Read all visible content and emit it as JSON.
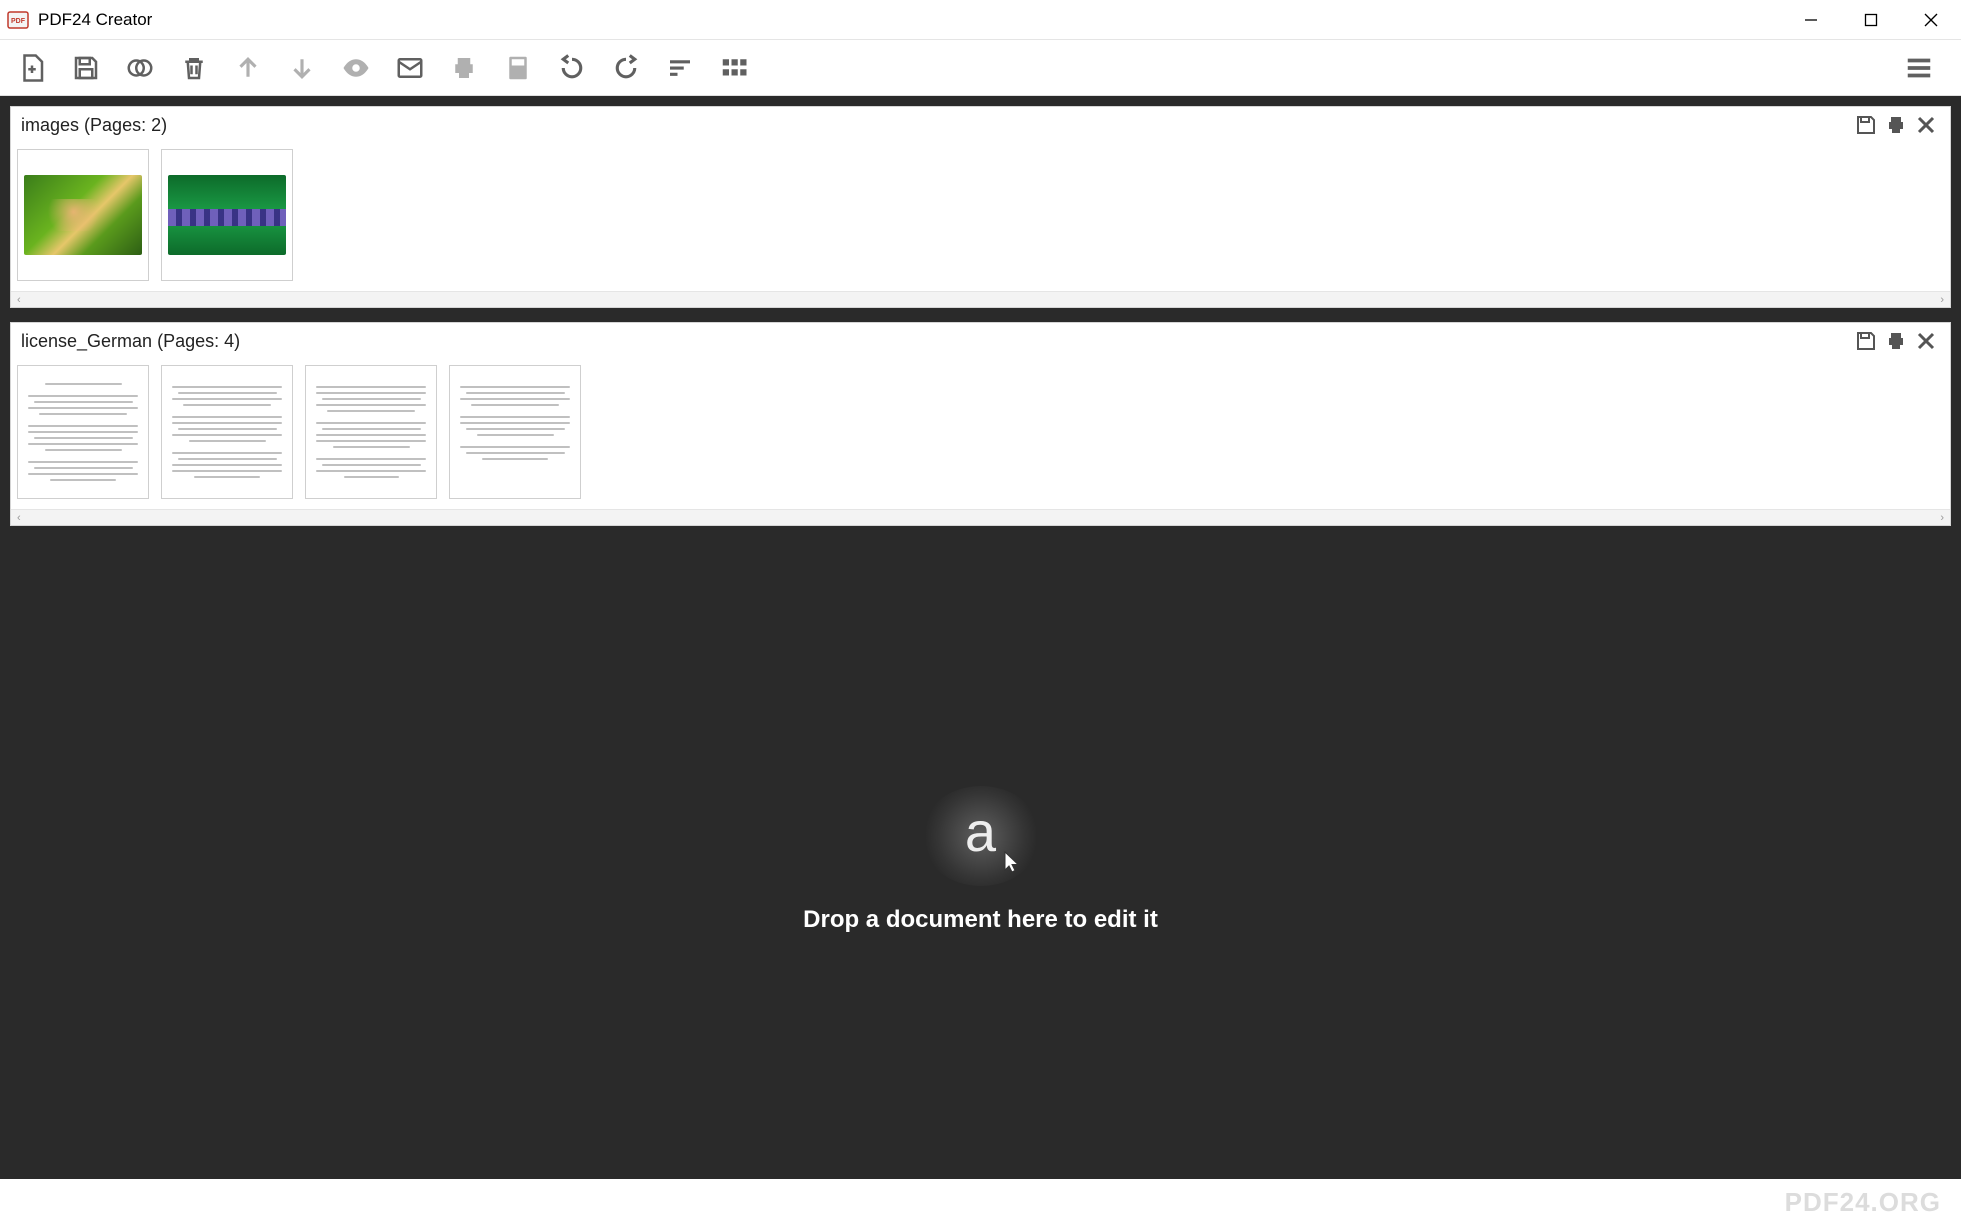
{
  "window": {
    "title": "PDF24 Creator"
  },
  "documents": [
    {
      "name": "images",
      "pages_label": "(Pages: 2)",
      "page_count": 2,
      "type": "image"
    },
    {
      "name": "license_German",
      "pages_label": "(Pages: 4)",
      "page_count": 4,
      "type": "pdf"
    }
  ],
  "dropzone": {
    "text": "Drop a document here to edit it"
  },
  "footer": {
    "text": "PDF24.ORG"
  },
  "toolbar": {
    "items": [
      "add-file",
      "save",
      "merge",
      "delete",
      "move-up",
      "move-down",
      "preview",
      "email",
      "print",
      "fax",
      "rotate-left",
      "rotate-right",
      "sort",
      "grid-view"
    ]
  }
}
